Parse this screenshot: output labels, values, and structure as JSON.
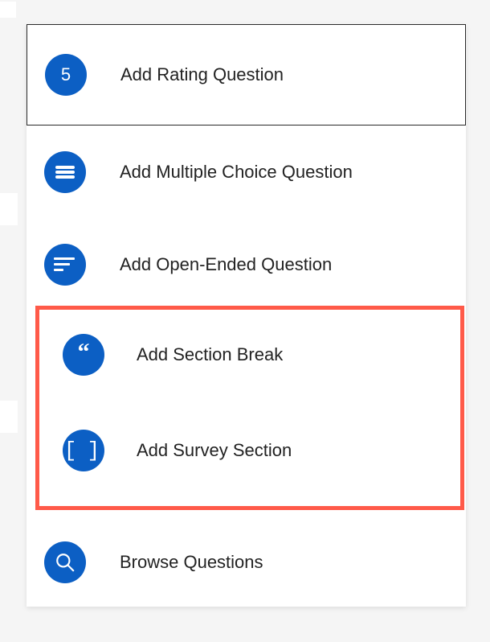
{
  "menu": {
    "rating": {
      "label": "Add Rating Question",
      "badge": "5"
    },
    "multiple": {
      "label": "Add Multiple Choice Question"
    },
    "open": {
      "label": "Add Open-Ended Question"
    },
    "section_break": {
      "label": "Add Section Break"
    },
    "survey_section": {
      "label": "Add Survey Section"
    },
    "browse": {
      "label": "Browse Questions"
    }
  }
}
